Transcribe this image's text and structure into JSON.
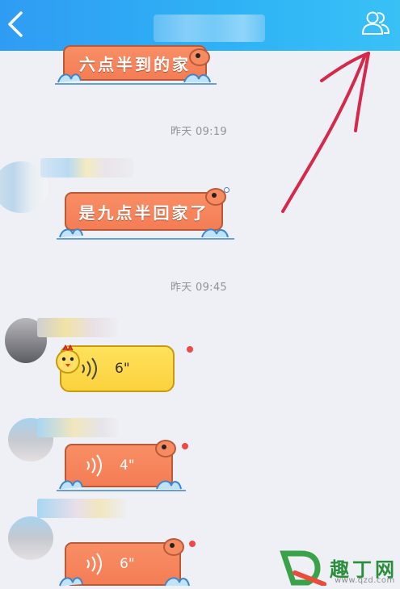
{
  "header": {
    "back_icon": "chevron-left-icon",
    "profile_icon": "group-members-icon",
    "accent_color": "#2fa8f4"
  },
  "messages": [
    {
      "type": "text",
      "text": "六点半到的家"
    },
    {
      "type": "time",
      "text": "昨天 09:19"
    },
    {
      "type": "text",
      "text": "是九点半回家了"
    },
    {
      "type": "time",
      "text": "昨天 09:45"
    },
    {
      "type": "voice",
      "duration": "6\"",
      "bubble_style": "yellow-chick",
      "unread": true
    },
    {
      "type": "voice",
      "duration": "4\"",
      "bubble_style": "orange-fish",
      "unread": true
    },
    {
      "type": "voice",
      "duration": "6\"",
      "bubble_style": "orange-fish",
      "unread": true
    }
  ],
  "watermark": {
    "brand": "趣丁网",
    "url": "www.qzd.com"
  },
  "colors": {
    "bubble_orange": "#f47d55",
    "bubble_yellow": "#fbd23d",
    "annotation_arrow": "#d6284a",
    "unread_dot": "#f04848"
  }
}
